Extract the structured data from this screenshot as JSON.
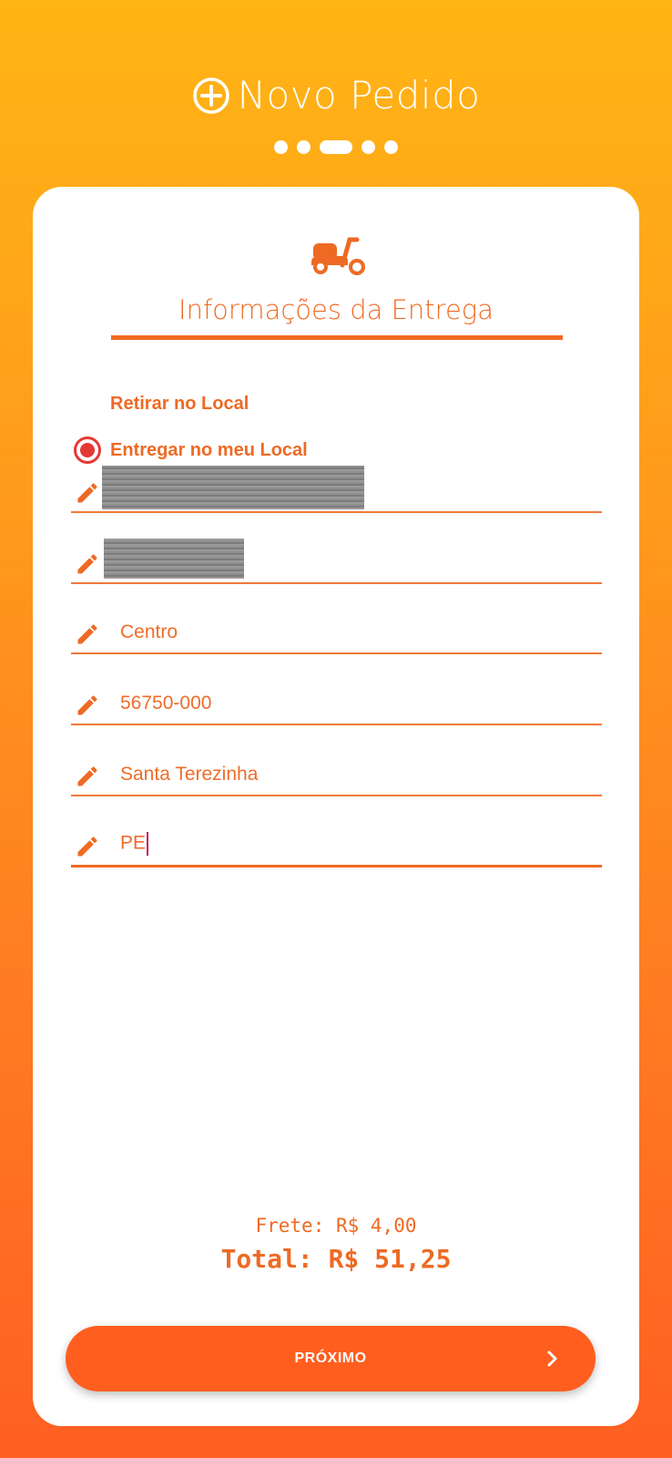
{
  "header": {
    "title": "Novo Pedido",
    "icon": "plus-circle-icon"
  },
  "stepper": {
    "total_steps": 5,
    "current_step": 3
  },
  "card": {
    "section_icon": "scooter-icon",
    "section_title": "Informações da Entrega",
    "delivery_options": [
      {
        "label": "Retirar no Local",
        "selected": false
      },
      {
        "label": "Entregar no meu Local",
        "selected": true
      }
    ],
    "fields": [
      {
        "value": "",
        "redacted": true
      },
      {
        "value": "",
        "redacted": true
      },
      {
        "value": "Centro",
        "redacted": false
      },
      {
        "value": "56750-000",
        "redacted": false
      },
      {
        "value": "Santa Terezinha",
        "redacted": false
      },
      {
        "value": "PE",
        "redacted": false,
        "focused": true
      }
    ],
    "frete": "Frete: R$ 4,00",
    "total": "Total: R$ 51,25",
    "next_button": {
      "label": "PRÓXIMO",
      "icon": "chevron-right-icon"
    }
  },
  "colors": {
    "accent": "#EE6A24",
    "radio": "#E53935",
    "button": "#FF5E1F",
    "gradient_top": "#FFB515",
    "gradient_bottom": "#FF5F22"
  }
}
